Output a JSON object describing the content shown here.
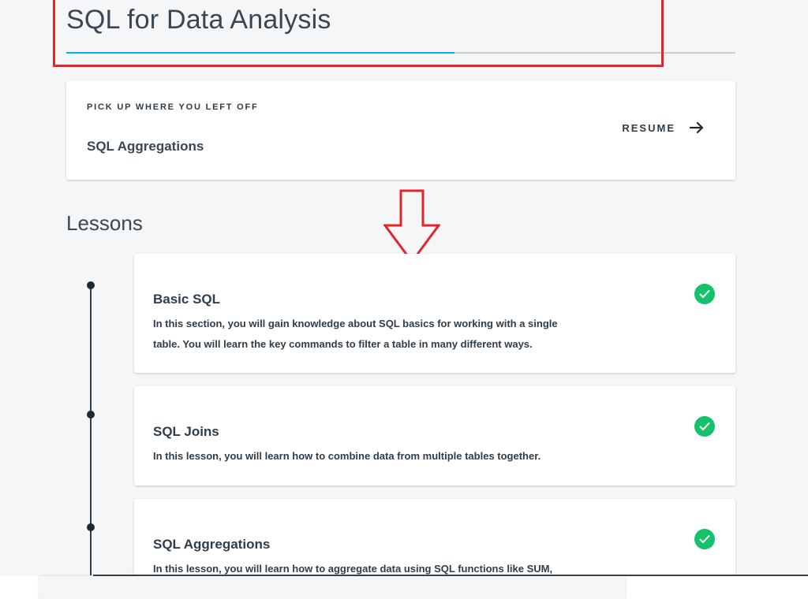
{
  "course": {
    "title": "SQL for Data Analysis",
    "progress": 0.58
  },
  "resume": {
    "eyebrow": "PICK UP WHERE YOU LEFT OFF",
    "lesson": "SQL Aggregations",
    "button_label": "RESUME",
    "button_icon": "arrow-right-icon"
  },
  "lessons_heading": "Lessons",
  "lessons": [
    {
      "title": "Basic SQL",
      "description": "In this section, you will gain knowledge about SQL basics for working with a single table. You will learn the key commands to filter a table in many different ways.",
      "completed": true,
      "status_icon": "check-circle-icon"
    },
    {
      "title": "SQL Joins",
      "description": "In this lesson, you will learn how to combine data from multiple tables together.",
      "completed": true,
      "status_icon": "check-circle-icon"
    },
    {
      "title": "SQL Aggregations",
      "description": "In this lesson, you will learn how to aggregate data using SQL functions like SUM,",
      "completed": true,
      "status_icon": "check-circle-icon"
    }
  ],
  "colors": {
    "accent": "#02b3e4",
    "success": "#15c26b",
    "annotation": "#e0262b"
  }
}
